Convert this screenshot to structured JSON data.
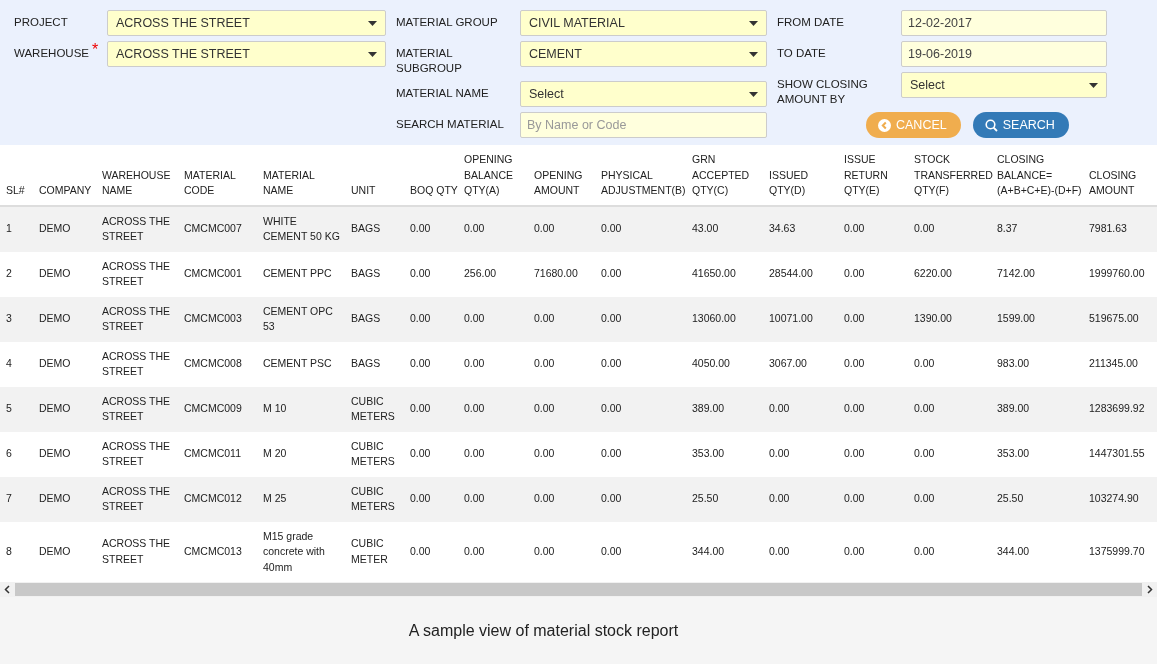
{
  "filters": {
    "groups": [
      [
        {
          "label": "PROJECT",
          "kind": "select",
          "value": "ACROSS THE STREET"
        },
        {
          "label": "WAREHOUSE",
          "required_mark": "*",
          "kind": "select",
          "value": "ACROSS THE STREET"
        }
      ],
      [
        {
          "label": "MATERIAL GROUP",
          "kind": "select",
          "value": "CIVIL MATERIAL"
        },
        {
          "label": "MATERIAL SUBGROUP",
          "kind": "select",
          "value": "CEMENT"
        },
        {
          "label": "MATERIAL NAME",
          "kind": "select",
          "value": "Select"
        },
        {
          "label": "SEARCH MATERIAL",
          "kind": "text",
          "placeholder": "By Name or Code"
        }
      ],
      [
        {
          "label": "FROM DATE",
          "kind": "date",
          "value": "12-02-2017"
        },
        {
          "label": "TO DATE",
          "kind": "date",
          "value": "19-06-2019"
        },
        {
          "label": "SHOW CLOSING AMOUNT BY",
          "kind": "select",
          "value": "Select"
        }
      ]
    ],
    "buttons": [
      {
        "label": "CANCEL",
        "kind": "cancel"
      },
      {
        "label": "SEARCH",
        "kind": "search"
      }
    ]
  },
  "table": {
    "columns": [
      "SL#",
      "COMPANY",
      "WAREHOUSE NAME",
      "MATERIAL CODE",
      "MATERIAL NAME",
      "UNIT",
      "BOQ QTY",
      "OPENING BALANCE QTY(A)",
      "OPENING AMOUNT",
      "PHYSICAL ADJUSTMENT(B)",
      "GRN ACCEPTED QTY(C)",
      "ISSUED QTY(D)",
      "ISSUE RETURN QTY(E)",
      "STOCK TRANSFERRED QTY(F)",
      "CLOSING BALANCE= (A+B+C+E)-(D+F)",
      "CLOSING AMOUNT"
    ],
    "rows": [
      [
        "1",
        "DEMO",
        "ACROSS THE STREET",
        "CMCMC007",
        "WHITE CEMENT 50 KG",
        "BAGS",
        "0.00",
        "0.00",
        "0.00",
        "0.00",
        "43.00",
        "34.63",
        "0.00",
        "0.00",
        "8.37",
        "7981.63"
      ],
      [
        "2",
        "DEMO",
        "ACROSS THE STREET",
        "CMCMC001",
        "CEMENT PPC",
        "BAGS",
        "0.00",
        "256.00",
        "71680.00",
        "0.00",
        "41650.00",
        "28544.00",
        "0.00",
        "6220.00",
        "7142.00",
        "1999760.00"
      ],
      [
        "3",
        "DEMO",
        "ACROSS THE STREET",
        "CMCMC003",
        "CEMENT OPC 53",
        "BAGS",
        "0.00",
        "0.00",
        "0.00",
        "0.00",
        "13060.00",
        "10071.00",
        "0.00",
        "1390.00",
        "1599.00",
        "519675.00"
      ],
      [
        "4",
        "DEMO",
        "ACROSS THE STREET",
        "CMCMC008",
        "CEMENT PSC",
        "BAGS",
        "0.00",
        "0.00",
        "0.00",
        "0.00",
        "4050.00",
        "3067.00",
        "0.00",
        "0.00",
        "983.00",
        "211345.00"
      ],
      [
        "5",
        "DEMO",
        "ACROSS THE STREET",
        "CMCMC009",
        "M 10",
        "CUBIC METERS",
        "0.00",
        "0.00",
        "0.00",
        "0.00",
        "389.00",
        "0.00",
        "0.00",
        "0.00",
        "389.00",
        "1283699.92"
      ],
      [
        "6",
        "DEMO",
        "ACROSS THE STREET",
        "CMCMC011",
        "M 20",
        "CUBIC METERS",
        "0.00",
        "0.00",
        "0.00",
        "0.00",
        "353.00",
        "0.00",
        "0.00",
        "0.00",
        "353.00",
        "1447301.55"
      ],
      [
        "7",
        "DEMO",
        "ACROSS THE STREET",
        "CMCMC012",
        "M 25",
        "CUBIC METERS",
        "0.00",
        "0.00",
        "0.00",
        "0.00",
        "25.50",
        "0.00",
        "0.00",
        "0.00",
        "25.50",
        "103274.90"
      ],
      [
        "8",
        "DEMO",
        "ACROSS THE STREET",
        "CMCMC013",
        "M15 grade concrete with 40mm",
        "CUBIC METER",
        "0.00",
        "0.00",
        "0.00",
        "0.00",
        "344.00",
        "0.00",
        "0.00",
        "0.00",
        "344.00",
        "1375999.70"
      ]
    ]
  },
  "caption": "A sample view of material stock report"
}
